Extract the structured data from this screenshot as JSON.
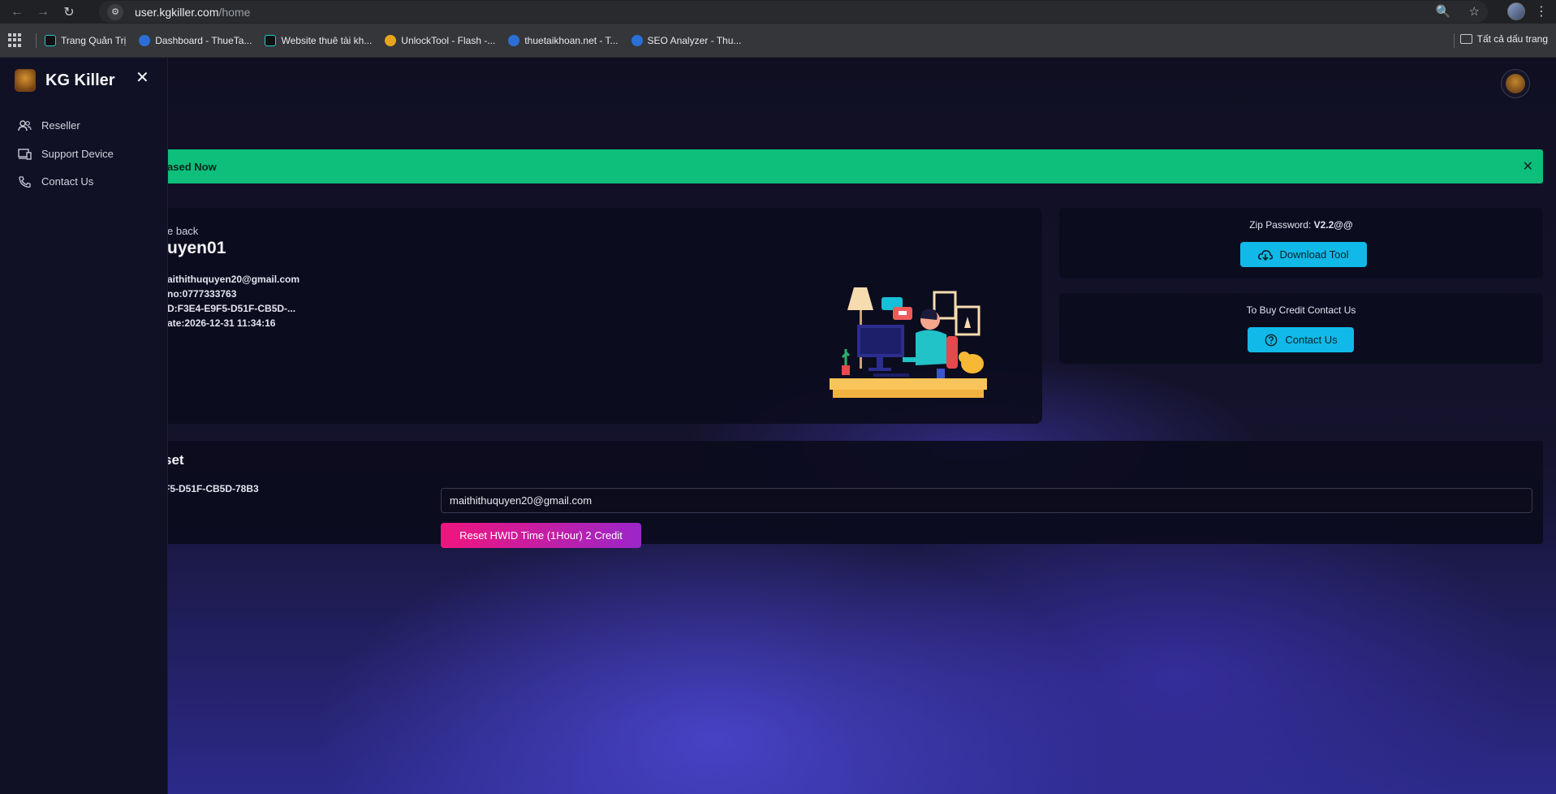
{
  "browser": {
    "url_host": "user.kgkiller.com",
    "url_path": "/home",
    "bookmarks": [
      {
        "label": "Trang Quản Trị"
      },
      {
        "label": "Dashboard - ThueTa..."
      },
      {
        "label": "Website thuê tài kh..."
      },
      {
        "label": "UnlockTool - Flash -..."
      },
      {
        "label": "thuetaikhoan.net - T..."
      },
      {
        "label": "SEO Analyzer - Thu..."
      }
    ],
    "all_bookmarks_label": "Tất cả dấu trang"
  },
  "sidebar": {
    "brand": "KG Killer",
    "items": [
      {
        "label": "Reseller",
        "icon": "users-icon"
      },
      {
        "label": "Support Device",
        "icon": "devices-icon"
      },
      {
        "label": "Contact Us",
        "icon": "phone-icon"
      }
    ]
  },
  "alert": {
    "text": "ased Now"
  },
  "welcome": {
    "greeting": "e back",
    "username": "uyen01",
    "info": [
      "aithithuquyen20@gmail.com",
      "no:0777333763",
      "D:F3E4-E9F5-D51F-CB5D-...",
      "ate:2026-12-31 11:34:16"
    ]
  },
  "download": {
    "zip_label": "Zip Password: ",
    "zip_value": "V2.2@@",
    "button": "Download Tool"
  },
  "buy": {
    "label": "To Buy Credit Contact Us",
    "button": "Contact Us"
  },
  "hwid": {
    "title": "set",
    "id": "F5-D51F-CB5D-78B3",
    "email_value": "maithithuquyen20@gmail.com",
    "reset_button": "Reset HWID Time (1Hour) 2 Credit"
  },
  "colors": {
    "accent_green": "#0dbf7b",
    "accent_cyan": "#11b9e8",
    "accent_pink": "#f0157d",
    "accent_purple": "#9b26c9"
  }
}
